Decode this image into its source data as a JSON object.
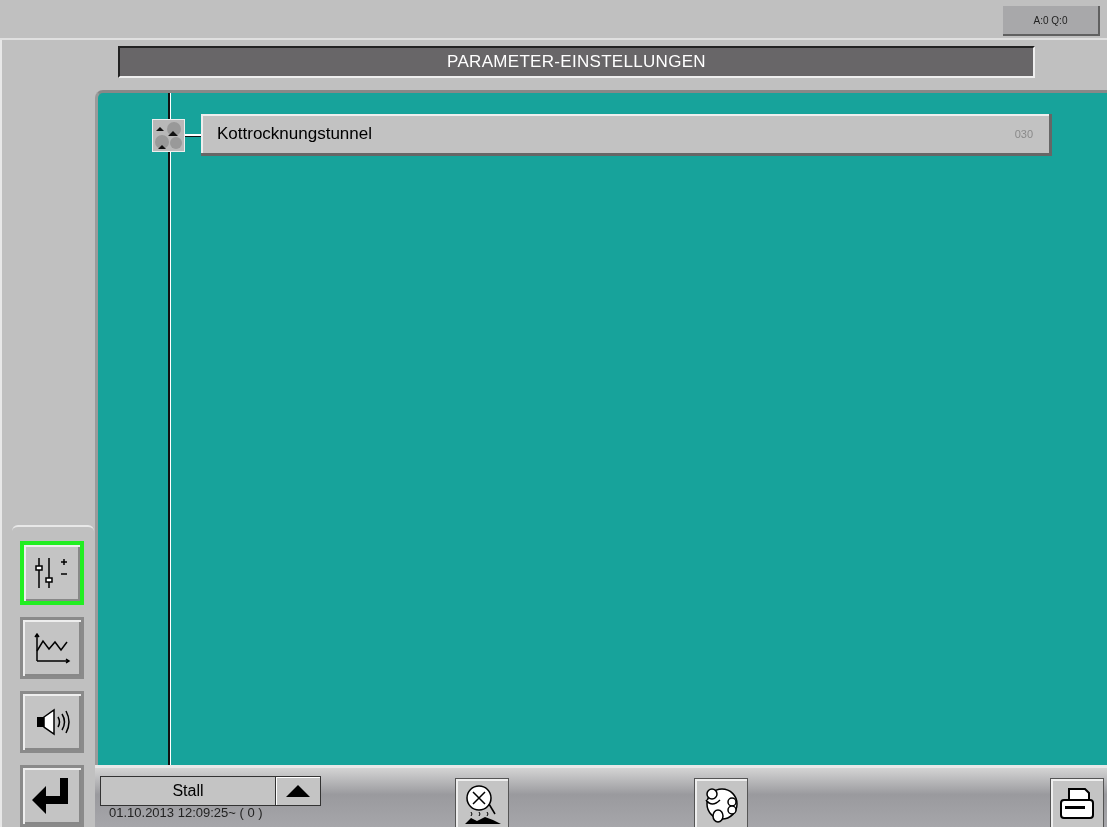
{
  "status_badge": "A:0 Q:0",
  "title": "PARAMETER-EINSTELLUNGEN",
  "tree_items": [
    {
      "label": "Kottrocknungstunnel",
      "code": "030"
    }
  ],
  "nav_buttons": [
    {
      "kind": "parameters",
      "selected": true
    },
    {
      "kind": "trend",
      "selected": false
    },
    {
      "kind": "alarm",
      "selected": false
    },
    {
      "kind": "enter",
      "selected": false
    }
  ],
  "status_bar": {
    "location": "Stall",
    "timestamp": "01.10.2013 12:09:25~ ( 0 )"
  }
}
